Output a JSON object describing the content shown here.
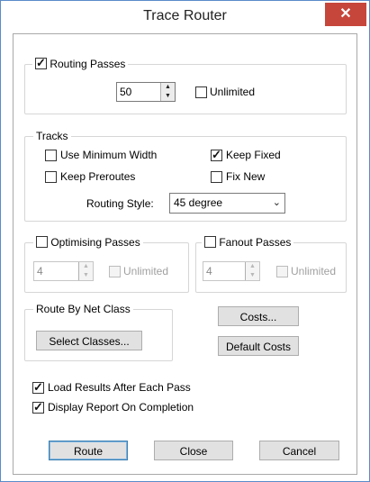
{
  "window": {
    "title": "Trace Router",
    "close_glyph": "✕"
  },
  "routing_passes": {
    "label": "Routing Passes",
    "checked": true,
    "value": "50",
    "unlimited_label": "Unlimited",
    "unlimited_checked": false
  },
  "tracks": {
    "legend": "Tracks",
    "use_min_width": "Use Minimum Width",
    "keep_fixed": "Keep Fixed",
    "keep_preroutes": "Keep Preroutes",
    "fix_new": "Fix New",
    "routing_style_label": "Routing Style:",
    "routing_style_value": "45 degree"
  },
  "optimising": {
    "label": "Optimising Passes",
    "value": "4",
    "unlimited_label": "Unlimited"
  },
  "fanout": {
    "label": "Fanout Passes",
    "value": "4",
    "unlimited_label": "Unlimited"
  },
  "net_class": {
    "legend": "Route By Net Class",
    "select_label": "Select Classes..."
  },
  "costs": {
    "costs_label": "Costs...",
    "default_label": "Default Costs"
  },
  "options": {
    "load_results": "Load Results After Each Pass",
    "display_report": "Display Report On Completion"
  },
  "actions": {
    "route": "Route",
    "close": "Close",
    "cancel": "Cancel"
  },
  "glyphs": {
    "check": "✓",
    "up": "▲",
    "down": "▼",
    "chevron": "⌄"
  },
  "colors": {
    "close_red": "#c7463b",
    "frame_blue": "#5a8bc8",
    "default_border": "#3c7fb1"
  }
}
